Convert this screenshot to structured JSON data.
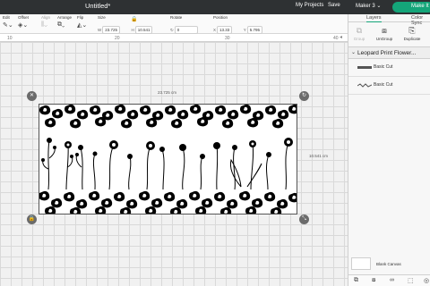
{
  "app": {
    "title": "Untitled*",
    "menu": [
      "My Projects",
      "Save"
    ],
    "machine": "Maker 3",
    "make_label": "Make It",
    "accent": "#14a579"
  },
  "toolbar": {
    "edit_label": "Edit",
    "offset_label": "Offset",
    "align_label": "Align",
    "arrange_label": "Arrange",
    "flip_label": "Flip",
    "size_label": "Size",
    "rotate_label": "Rotate",
    "position_label": "Position",
    "w_prefix": "W",
    "w_value": "23.725",
    "h_prefix": "H",
    "h_value": "10.541",
    "rotate_value": "0",
    "x_prefix": "X",
    "x_value": "13.33",
    "y_prefix": "Y",
    "y_value": "5.795"
  },
  "ruler": {
    "ticks": [
      "10",
      "20",
      "30",
      "40"
    ]
  },
  "canvas": {
    "width_label": "23.725 cm",
    "height_label": "10.541 cm"
  },
  "panel": {
    "tabs": [
      "Layers",
      "Color Sync"
    ],
    "actions": [
      "Group",
      "UnGroup",
      "Duplicate"
    ],
    "group_name": "Leopard Print Flower...",
    "layers": [
      {
        "name": "Basic Cut"
      },
      {
        "name": "Basic Cut"
      }
    ],
    "blank_canvas_label": "Blank Canvas"
  }
}
